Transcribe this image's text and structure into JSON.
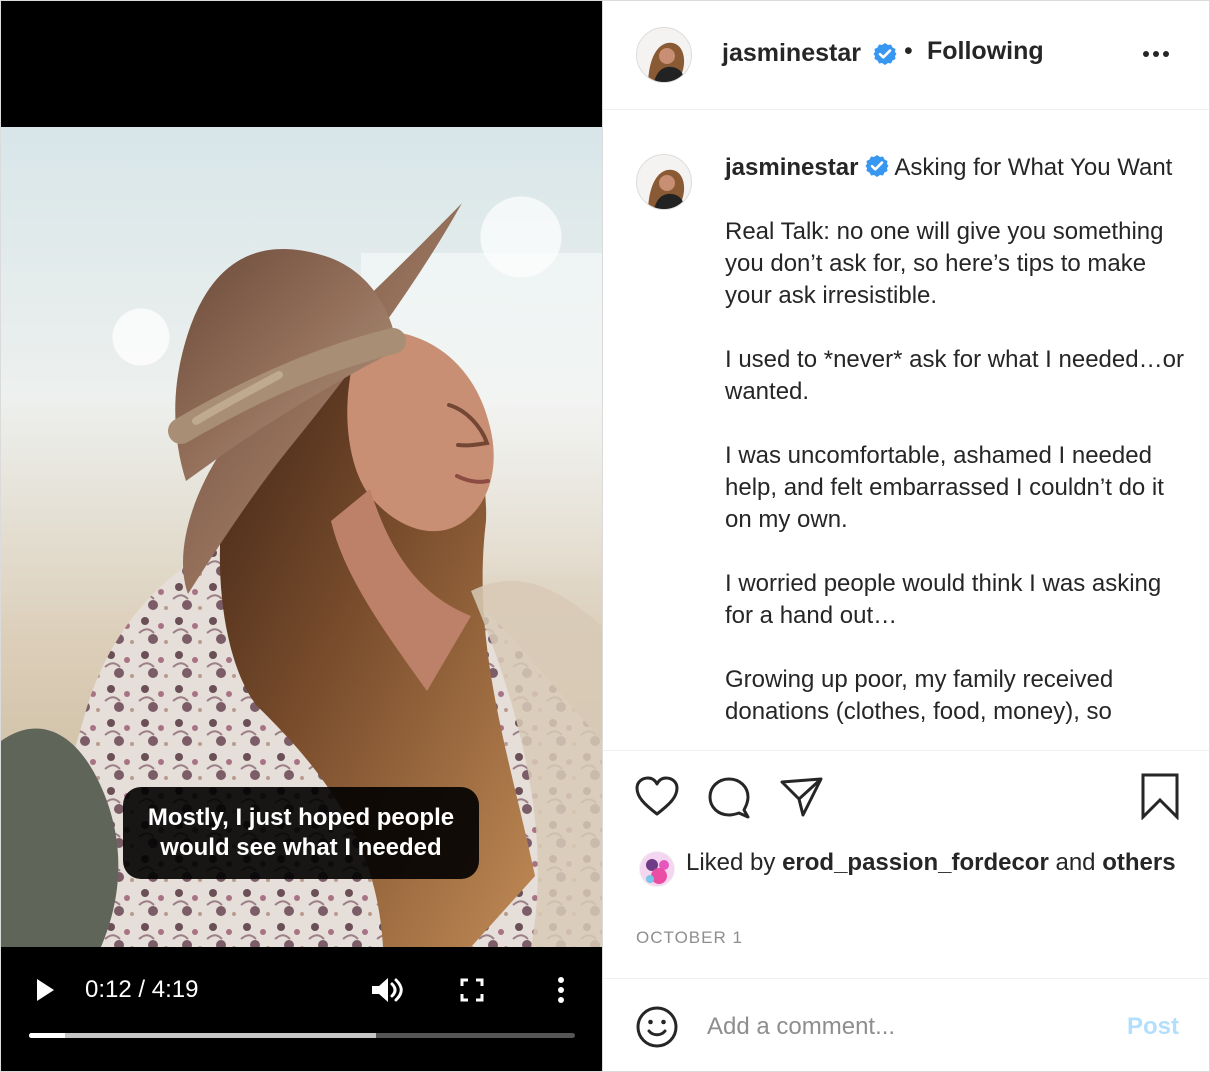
{
  "video": {
    "subtitle_lines": [
      "Mostly, I just hoped people",
      "would see what I needed"
    ],
    "time_readout": "0:12 / 4:19",
    "played_fraction": 0.066,
    "buffered_fraction": 0.635
  },
  "post": {
    "username": "jasminestar",
    "follow_status": "Following",
    "separator": "•",
    "caption": {
      "title": "Asking for What You Want",
      "body": "\n\nReal Talk: no one will give you something you don’t ask for, so here’s tips to make your ask irresistible.\n\nI used to *never* ask for what I needed…or wanted.\n\nI was uncomfortable, ashamed I needed help, and felt embarrassed I couldn’t do it on my own.\n\nI worried people would think I was asking for a hand out…\n\nGrowing up poor, my family received donations (clothes, food, money), so"
    },
    "likes": {
      "prefix": "Liked by",
      "liked_by_user": "erod_passion_fordecor",
      "connector": "and",
      "others_label": "others"
    },
    "date": "OCTOBER 1"
  },
  "comment_box": {
    "placeholder": "Add a comment...",
    "post_label": "Post"
  },
  "icons": {
    "verified": "verified-badge-icon",
    "more": "more-horizontal-icon",
    "like": "heart-icon",
    "comment": "comment-bubble-icon",
    "share": "paper-plane-icon",
    "save": "bookmark-icon",
    "emoji": "emoji-smile-icon",
    "video_play": "play-icon",
    "volume": "volume-icon",
    "fullscreen": "fullscreen-icon",
    "video_more": "vertical-more-icon"
  },
  "colors": {
    "text": "#262626",
    "muted": "#8e8e8e",
    "border": "#dbdbdb",
    "verified": "#3897f0",
    "post_disabled": "#b2dffc",
    "video_background": "#000000"
  }
}
